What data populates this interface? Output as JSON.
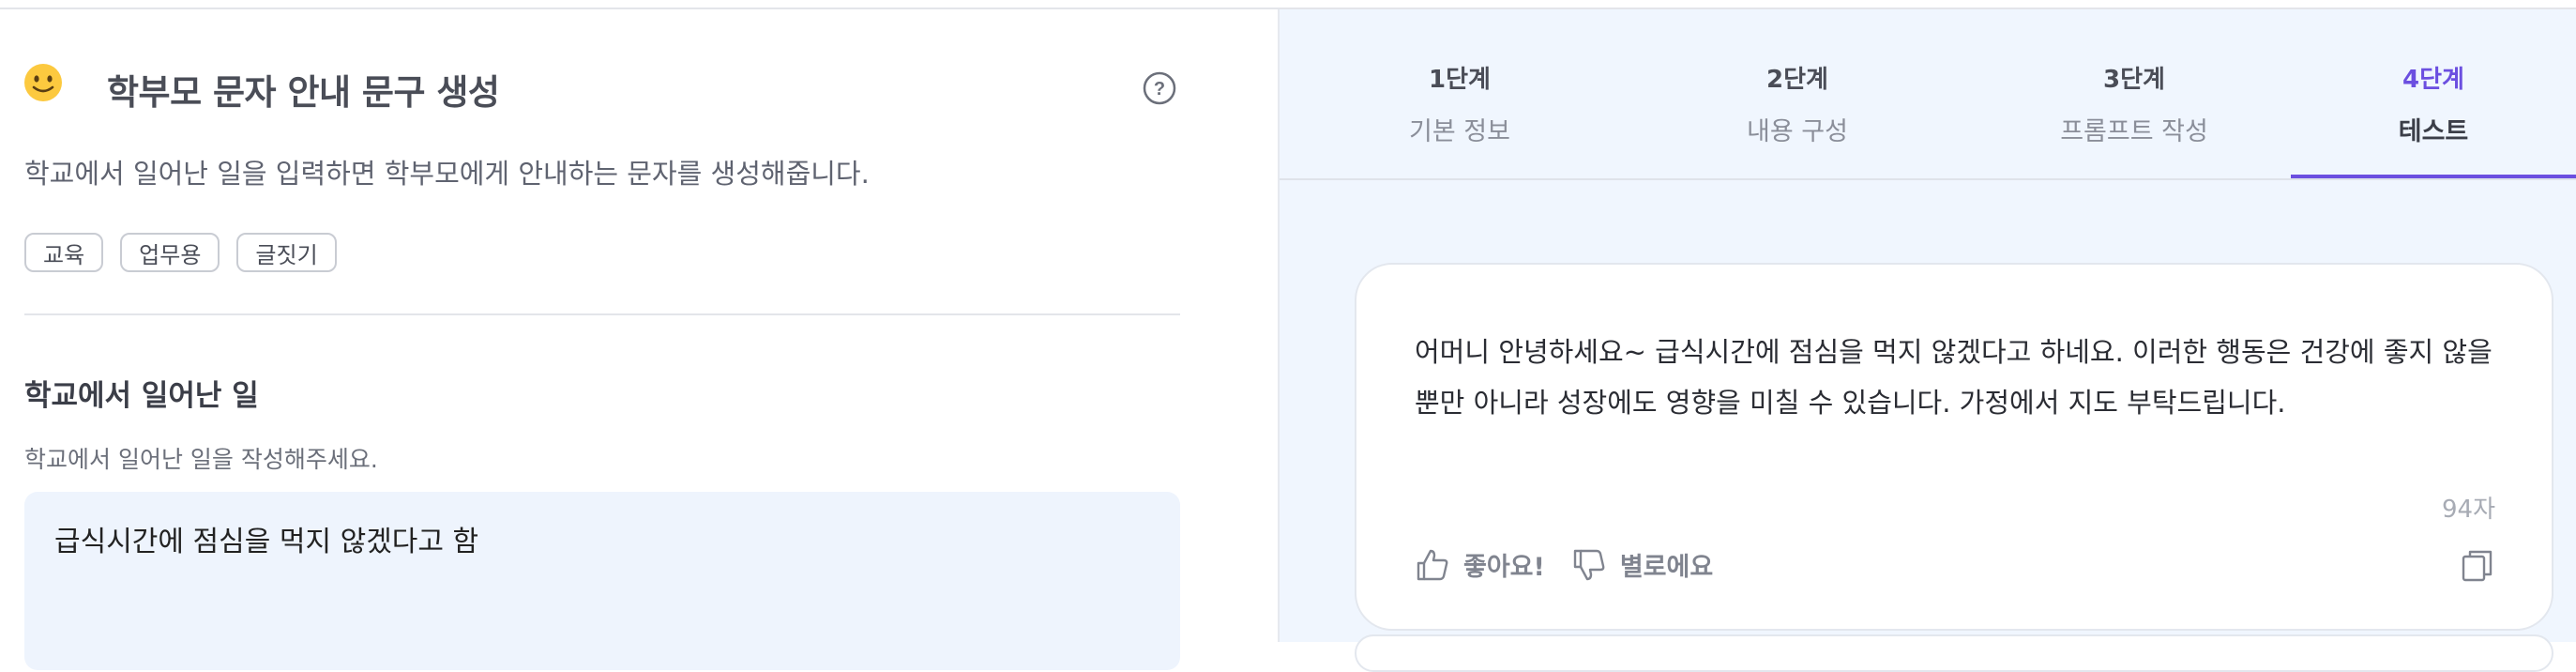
{
  "header": {
    "title": "학부모 문자 안내 문구 생성",
    "description": "학교에서 일어난 일을 입력하면 학부모에게 안내하는 문자를 생성해줍니다.",
    "tags": [
      "교육",
      "업무용",
      "글짓기"
    ]
  },
  "form": {
    "label": "학교에서 일어난 일",
    "helper": "학교에서 일어난 일을 작성해주세요.",
    "value": "급식시간에 점심을 먹지 않겠다고 함"
  },
  "steps": [
    {
      "num": "1단계",
      "name": "기본 정보"
    },
    {
      "num": "2단계",
      "name": "내용 구성"
    },
    {
      "num": "3단계",
      "name": "프롬프트 작성"
    },
    {
      "num": "4단계",
      "name": "테스트"
    }
  ],
  "result": {
    "text": "어머니 안녕하세요~ 급식시간에 점심을 먹지 않겠다고 하네요. 이러한 행동은 건강에 좋지 않을 뿐만 아니라 성장에도 영향을 미칠 수 있습니다. 가정에서 지도 부탁드립니다.",
    "char_count": "94자",
    "like_label": "좋아요!",
    "dislike_label": "별로에요"
  },
  "colors": {
    "accent": "#6b4fe0",
    "panel_bg": "#f0f6fe",
    "input_bg": "#eef4fd"
  },
  "icons": [
    "smiley-icon",
    "help-icon",
    "thumbs-up-icon",
    "thumbs-down-icon",
    "copy-icon"
  ]
}
